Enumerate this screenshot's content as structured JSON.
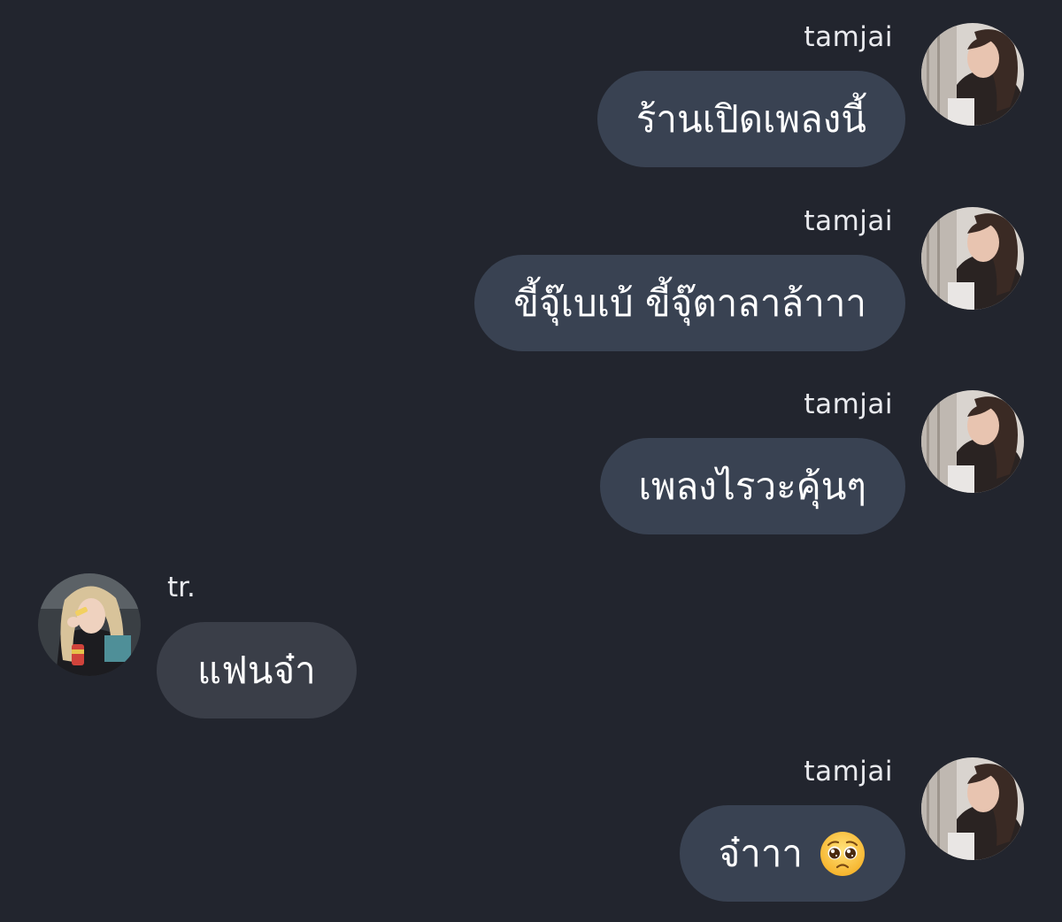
{
  "messages": [
    {
      "sender": "tamjai",
      "side": "right",
      "text": "ร้านเปิดเพลงนี้"
    },
    {
      "sender": "tamjai",
      "side": "right",
      "text": "ขี้จุ๊เบเบ้ ขี้จุ๊ตาลาล้าาา"
    },
    {
      "sender": "tamjai",
      "side": "right",
      "text": "เพลงไรวะคุ้นๆ"
    },
    {
      "sender": "tr.",
      "side": "left",
      "text": "แฟนจ๋า"
    },
    {
      "sender": "tamjai",
      "side": "right",
      "text": "จ๋าาา",
      "emoji": "pleading-face-icon"
    }
  ],
  "avatars": {
    "tamjai": "avatar-tamjai",
    "tr": "avatar-tr"
  },
  "colors": {
    "background": "#22252e",
    "bubble_outgoing": "#394252",
    "bubble_incoming": "#3a3e48",
    "text": "#ffffff"
  }
}
